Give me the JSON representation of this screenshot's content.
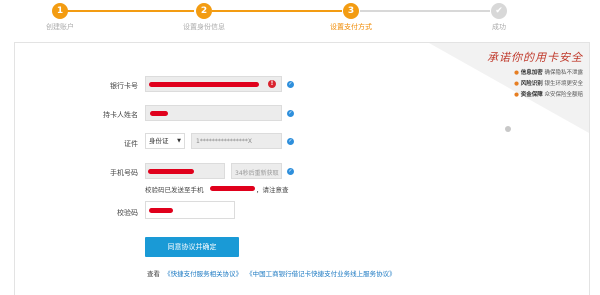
{
  "steps": [
    {
      "number": "1",
      "label": "创建账户",
      "state": "done"
    },
    {
      "number": "2",
      "label": "设置身份信息",
      "state": "done"
    },
    {
      "number": "3",
      "label": "设置支付方式",
      "state": "active"
    },
    {
      "number": "✔",
      "label": "成功",
      "state": "pending"
    }
  ],
  "promise": {
    "title": "承诺你的用卡安全",
    "rows": [
      {
        "bullet": "●",
        "key": "信息加密",
        "text": "确保隐私不泄露"
      },
      {
        "bullet": "●",
        "key": "风险识别",
        "text": "银生环境更安全"
      },
      {
        "bullet": "●",
        "key": "资金保障",
        "text": "众安保险全额赔"
      }
    ]
  },
  "form": {
    "card_number_label": "银行卡号",
    "cardholder_label": "持卡人姓名",
    "id_label": "证件",
    "id_type": "身份证",
    "id_value": "1****************X",
    "phone_label": "手机号码",
    "code_button": "34秒后重新获取",
    "sms_note_prefix": "校验码已发送至手机",
    "sms_note_suffix": "，请注意查",
    "verify_label": "校验码"
  },
  "button_label": "同意协议并确定",
  "footer": {
    "prefix": "查看",
    "link1": "《快捷支付服务相关协议》",
    "link2": "《中国工商银行借记卡快捷支付业务线上服务协议》"
  },
  "colors": {
    "accent": "#f39c12",
    "button": "#1a9ad6",
    "redaction": "#e0001c",
    "check": "#2e8fdc"
  }
}
